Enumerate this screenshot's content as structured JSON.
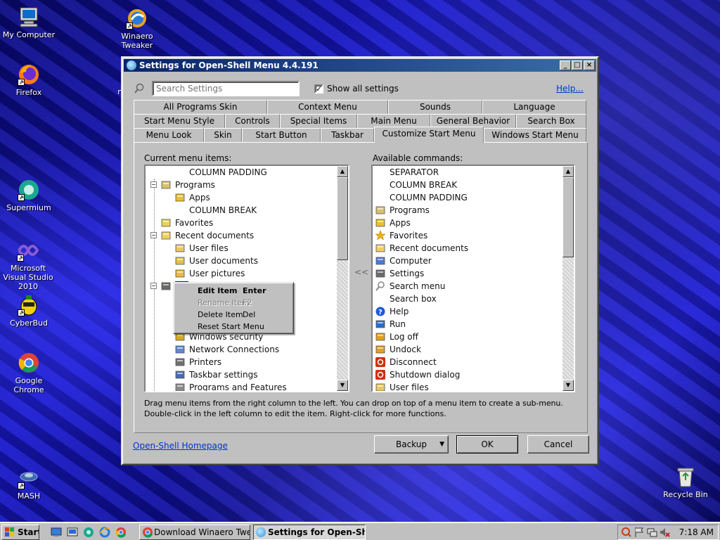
{
  "desktop": {
    "icons": [
      {
        "label": "My Computer",
        "icon": "my-computer-icon"
      },
      {
        "label": "Winaero Tweaker",
        "icon": "winaero-tweaker-icon"
      },
      {
        "label": "Firefox",
        "icon": "firefox-icon"
      },
      {
        "label": "Supermium",
        "icon": "supermium-icon"
      },
      {
        "label": "Microsoft Visual Studio 2010",
        "icon": "visual-studio-icon"
      },
      {
        "label": "CyberBud",
        "icon": "cyberbud-icon"
      },
      {
        "label": "Google Chrome",
        "icon": "chrome-icon"
      },
      {
        "label": "MASH",
        "icon": "mash-icon"
      },
      {
        "label": "Recycle Bin",
        "icon": "recycle-bin-icon"
      }
    ],
    "partial_label": "m"
  },
  "window": {
    "title": "Settings for Open-Shell Menu 4.4.191",
    "search_placeholder": "Search Settings",
    "show_all_label": "Show all settings",
    "show_all_checked": true,
    "help_link": "Help...",
    "tabs_row1": [
      "All Programs Skin",
      "Context Menu",
      "Sounds",
      "Language"
    ],
    "tabs_row2": [
      "Start Menu Style",
      "Controls",
      "Special Items",
      "Main Menu",
      "General Behavior",
      "Search Box"
    ],
    "tabs_row3": [
      "Menu Look",
      "Skin",
      "Start Button",
      "Taskbar",
      "Customize Start Menu",
      "Windows Start Menu"
    ],
    "active_tab": "Customize Start Menu",
    "current_label": "Current menu items:",
    "available_label": "Available commands:",
    "move_left_label": "<<",
    "current_items": [
      {
        "label": "COLUMN PADDING",
        "icon": "",
        "level": 1
      },
      {
        "label": "Programs",
        "icon": "programs-icon",
        "level": 0,
        "expander": "−"
      },
      {
        "label": "Apps",
        "icon": "apps-icon",
        "level": 1
      },
      {
        "label": "COLUMN BREAK",
        "icon": "",
        "level": 1
      },
      {
        "label": "Favorites",
        "icon": "favorites-icon",
        "level": 0
      },
      {
        "label": "Recent documents",
        "icon": "recent-documents-icon",
        "level": 0,
        "expander": "−"
      },
      {
        "label": "User files",
        "icon": "user-files-icon",
        "level": 1
      },
      {
        "label": "User documents",
        "icon": "user-documents-icon",
        "level": 1
      },
      {
        "label": "User pictures",
        "icon": "user-pictures-icon",
        "level": 1
      },
      {
        "label": "Se",
        "icon": "settings-icon",
        "level": 0,
        "expander": "−",
        "selected": true
      },
      {
        "label": "",
        "icon": "blank-doc-icon",
        "level": 1
      },
      {
        "label": "",
        "icon": "control-panel-icon",
        "level": 1
      },
      {
        "label": "",
        "icon": "",
        "level": 1
      },
      {
        "label": "Windows security",
        "icon": "lock-icon",
        "level": 1
      },
      {
        "label": "Network Connections",
        "icon": "network-icon",
        "level": 1
      },
      {
        "label": "Printers",
        "icon": "printer-icon",
        "level": 1
      },
      {
        "label": "Taskbar settings",
        "icon": "taskbar-icon",
        "level": 1
      },
      {
        "label": "Programs and Features",
        "icon": "programs-features-icon",
        "level": 1
      }
    ],
    "available_items": [
      {
        "label": "SEPARATOR",
        "icon": ""
      },
      {
        "label": "COLUMN BREAK",
        "icon": ""
      },
      {
        "label": "COLUMN PADDING",
        "icon": ""
      },
      {
        "label": "Programs",
        "icon": "programs-icon"
      },
      {
        "label": "Apps",
        "icon": "apps-icon"
      },
      {
        "label": "Favorites",
        "icon": "favorites-star-icon"
      },
      {
        "label": "Recent documents",
        "icon": "recent-documents-icon"
      },
      {
        "label": "Computer",
        "icon": "computer-icon"
      },
      {
        "label": "Settings",
        "icon": "settings-icon"
      },
      {
        "label": "Search menu",
        "icon": "search-icon"
      },
      {
        "label": "Search box",
        "icon": ""
      },
      {
        "label": "Help",
        "icon": "help-icon"
      },
      {
        "label": "Run",
        "icon": "run-icon"
      },
      {
        "label": "Log off",
        "icon": "log-off-icon"
      },
      {
        "label": "Undock",
        "icon": "undock-icon"
      },
      {
        "label": "Disconnect",
        "icon": "disconnect-icon"
      },
      {
        "label": "Shutdown dialog",
        "icon": "shutdown-icon"
      },
      {
        "label": "User files",
        "icon": "user-files-icon"
      }
    ],
    "hint_line1": "Drag menu items from the right column to the left. You can drop on top of a menu item to create a sub-menu.",
    "hint_line2": "Double-click in the left column to edit the item. Right-click for more functions.",
    "homepage_link": "Open-Shell Homepage",
    "backup_label": "Backup",
    "ok_label": "OK",
    "cancel_label": "Cancel"
  },
  "context_menu": {
    "items": [
      {
        "label": "Edit Item",
        "shortcut": "Enter",
        "enabled": true,
        "bold": true
      },
      {
        "label": "Rename Item",
        "shortcut": "F2",
        "enabled": false
      },
      {
        "label": "Delete Item",
        "shortcut": "Del",
        "enabled": true
      },
      {
        "label": "Reset Start Menu",
        "shortcut": "",
        "enabled": true
      }
    ]
  },
  "taskbar": {
    "start_label": "Start",
    "tasks": [
      {
        "label": "Download Winaero Twea...",
        "active": false
      },
      {
        "label": "Settings for Open-She...",
        "active": true
      }
    ],
    "clock": "7:18 AM"
  }
}
